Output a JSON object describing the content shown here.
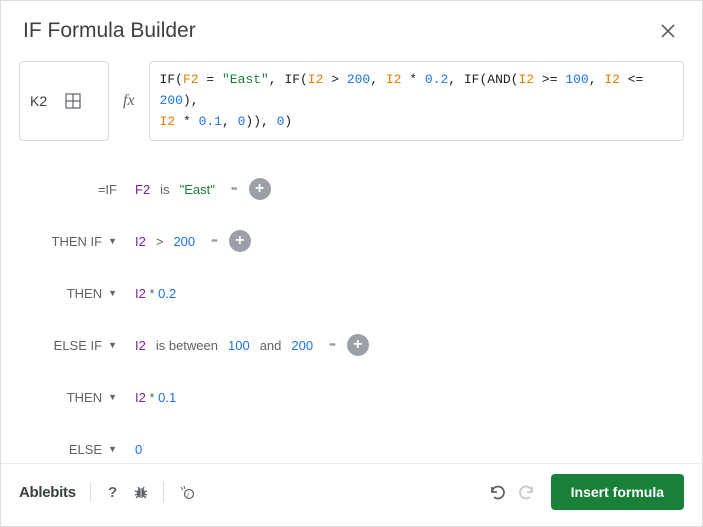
{
  "header": {
    "title": "IF Formula Builder"
  },
  "cell_ref": "K2",
  "fx_label": "fx",
  "formula_parts": [
    {
      "t": "func",
      "v": "IF("
    },
    {
      "t": "cell",
      "v": "F2"
    },
    {
      "t": "op",
      "v": " = "
    },
    {
      "t": "str",
      "v": "\"East\""
    },
    {
      "t": "op",
      "v": ", "
    },
    {
      "t": "func",
      "v": "IF("
    },
    {
      "t": "cell",
      "v": "I2"
    },
    {
      "t": "op",
      "v": " > "
    },
    {
      "t": "num",
      "v": "200"
    },
    {
      "t": "op",
      "v": ", "
    },
    {
      "t": "cell",
      "v": "I2"
    },
    {
      "t": "op",
      "v": " * "
    },
    {
      "t": "num",
      "v": "0.2"
    },
    {
      "t": "op",
      "v": ", "
    },
    {
      "t": "func",
      "v": "IF("
    },
    {
      "t": "func",
      "v": "AND("
    },
    {
      "t": "cell",
      "v": "I2"
    },
    {
      "t": "op",
      "v": " >= "
    },
    {
      "t": "num",
      "v": "100"
    },
    {
      "t": "op",
      "v": ", "
    },
    {
      "t": "cell",
      "v": "I2"
    },
    {
      "t": "op",
      "v": " <= "
    },
    {
      "t": "num",
      "v": "200"
    },
    {
      "t": "op",
      "v": "), "
    },
    {
      "t": "br",
      "v": ""
    },
    {
      "t": "cell",
      "v": "I2"
    },
    {
      "t": "op",
      "v": " * "
    },
    {
      "t": "num",
      "v": "0.1"
    },
    {
      "t": "op",
      "v": ", "
    },
    {
      "t": "num",
      "v": "0"
    },
    {
      "t": "op",
      "v": ")), "
    },
    {
      "t": "num",
      "v": "0"
    },
    {
      "t": "op",
      "v": ")"
    }
  ],
  "rules": {
    "r0": {
      "label": "=IF",
      "cell": "F2",
      "op": "is",
      "val_prefix": "\"",
      "val": "East",
      "val_suffix": "\""
    },
    "r1": {
      "label": "THEN IF",
      "cell": "I2",
      "op": ">",
      "val": "200"
    },
    "r2": {
      "label": "THEN",
      "cell": "I2",
      "op": "*",
      "val": "0.2"
    },
    "r3": {
      "label": "ELSE IF",
      "cell": "I2",
      "op": "is between",
      "v1": "100",
      "and": "and",
      "v2": "200"
    },
    "r4": {
      "label": "THEN",
      "cell": "I2",
      "op": "*",
      "val": "0.1"
    },
    "r5": {
      "label": "ELSE",
      "val": "0"
    }
  },
  "footer": {
    "brand": "Ablebits",
    "insert": "Insert formula"
  }
}
